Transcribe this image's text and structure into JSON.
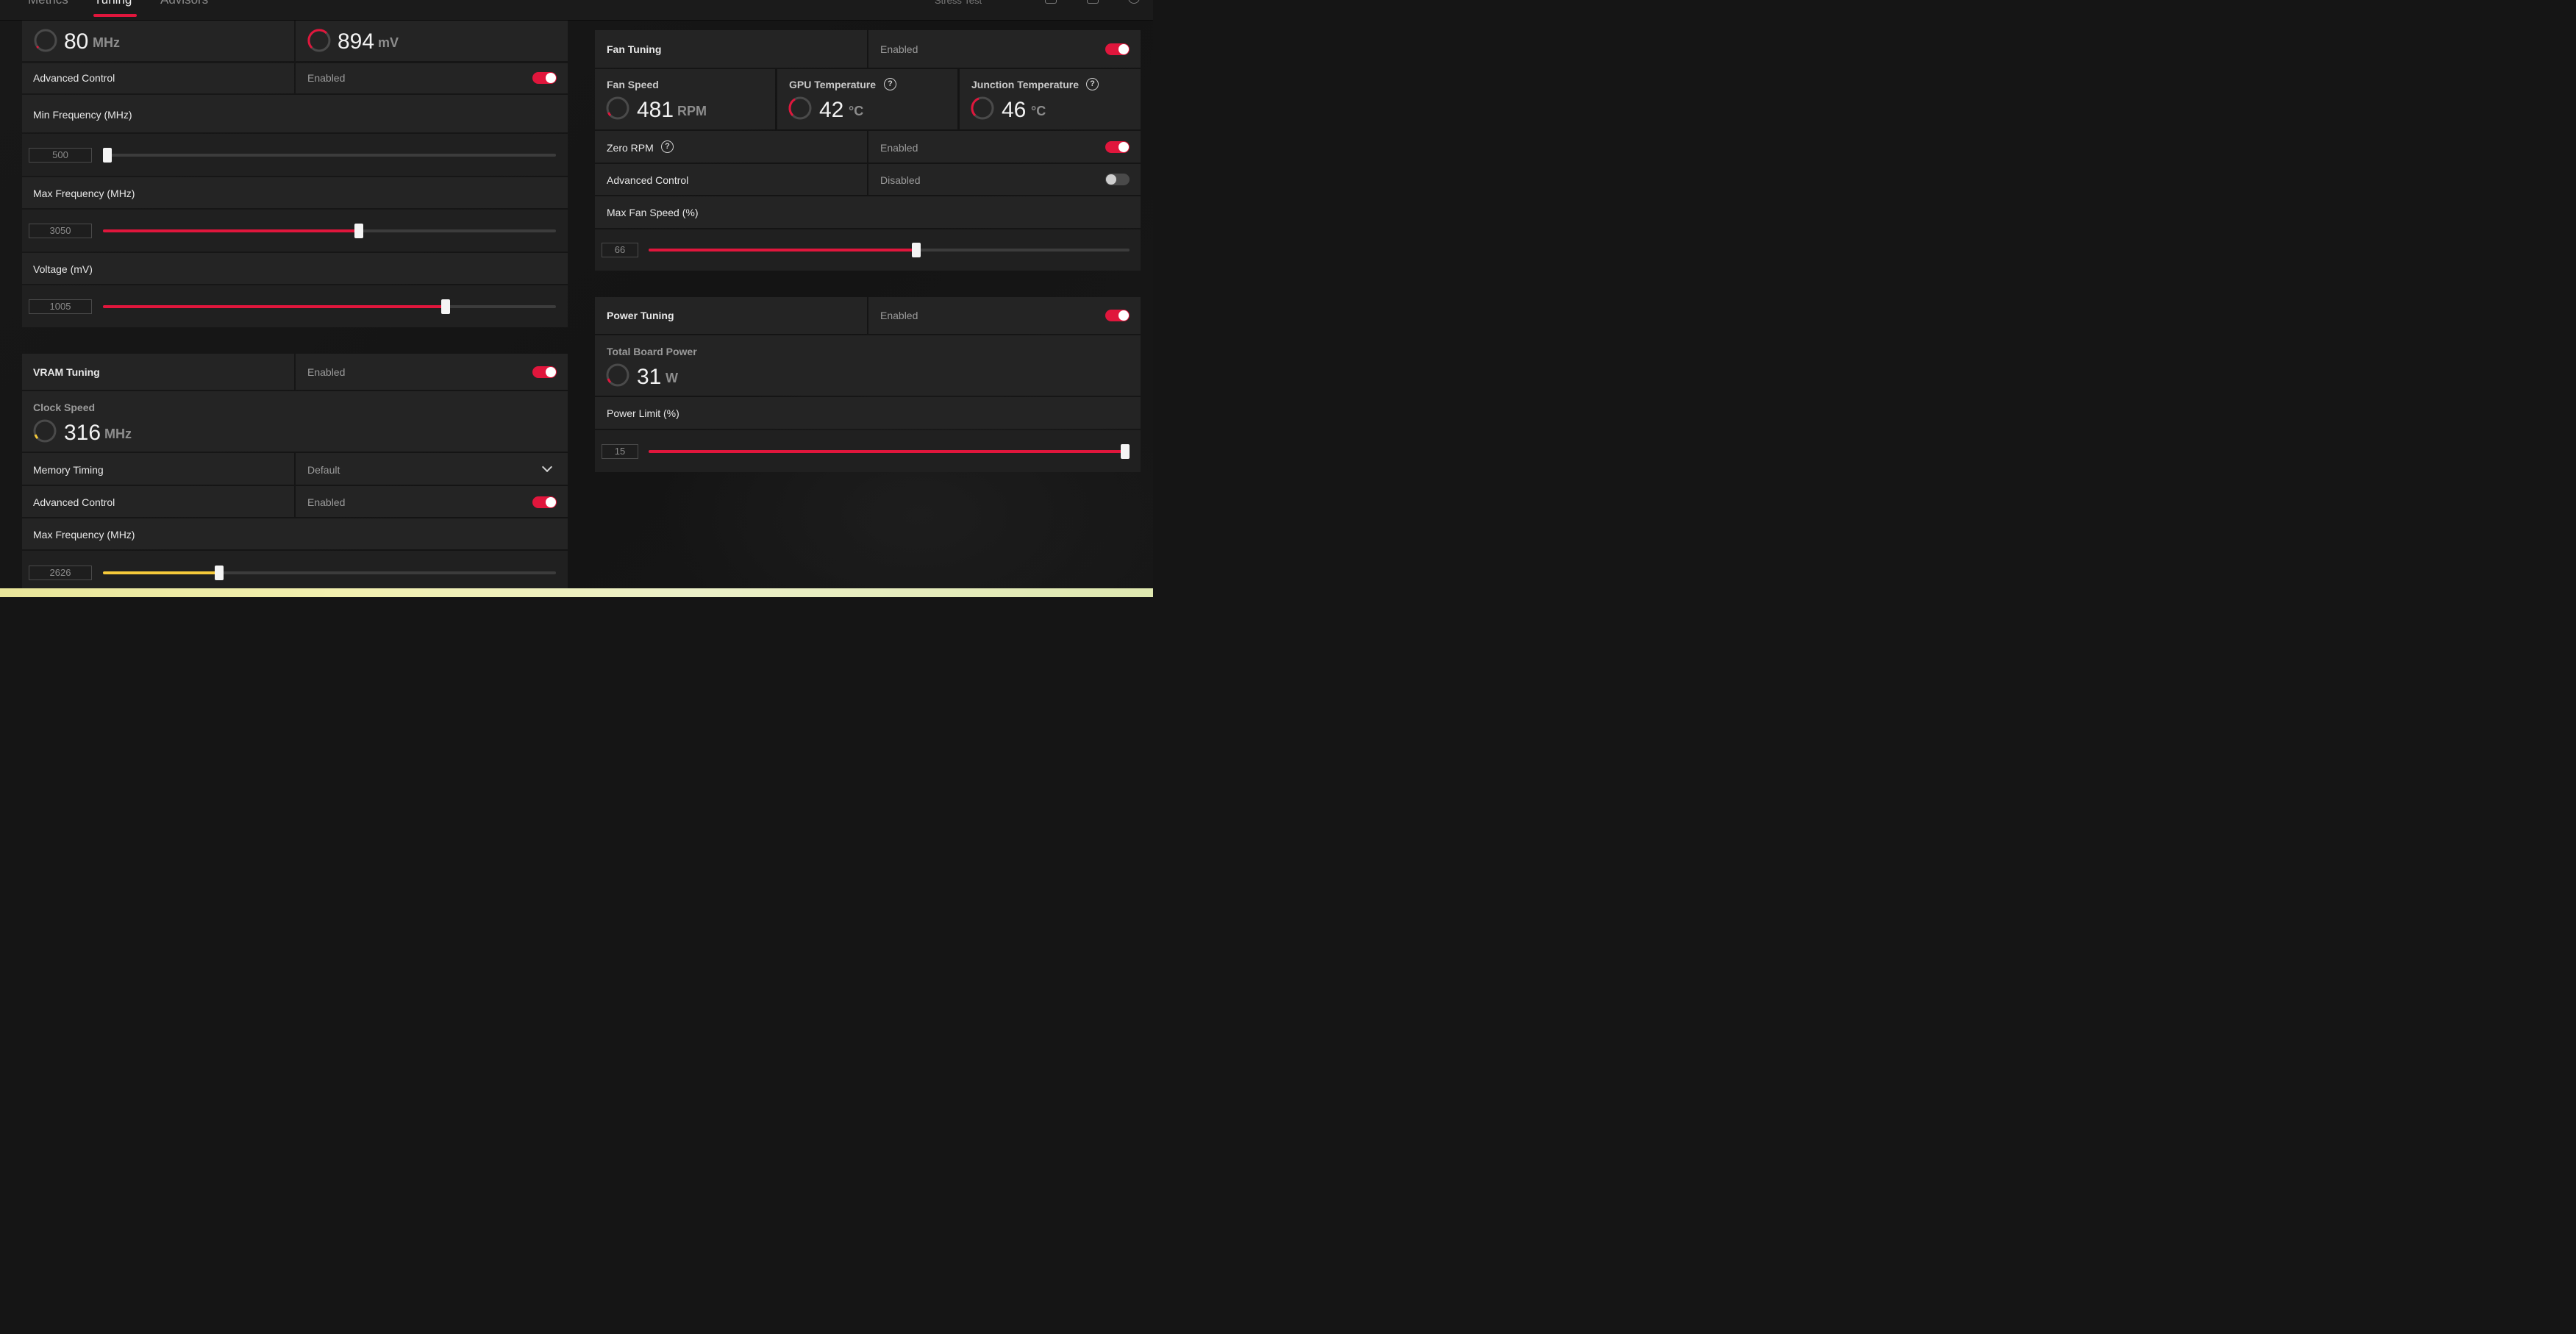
{
  "tabs": {
    "metrics": "Metrics",
    "tuning": "Tuning",
    "advisors": "Advisors"
  },
  "top_right": {
    "stress_test": "Stress Test"
  },
  "gpu_tuning": {
    "clock_value": "80",
    "clock_unit": "MHz",
    "voltage_value": "894",
    "voltage_unit": "mV",
    "advanced_control": {
      "label": "Advanced Control",
      "state": "Enabled",
      "enabled": true
    },
    "min_frequency": {
      "label": "Min Frequency (MHz)",
      "value": "500",
      "min": 500,
      "max": 3050,
      "current": 500
    },
    "max_frequency": {
      "label": "Max Frequency (MHz)",
      "value": "3050",
      "fraction": 0.565
    },
    "voltage": {
      "label": "Voltage (mV)",
      "value": "1005",
      "fraction": 0.756
    }
  },
  "vram_tuning": {
    "title": "VRAM Tuning",
    "state": "Enabled",
    "enabled": true,
    "clock_label": "Clock Speed",
    "clock_value": "316",
    "clock_unit": "MHz",
    "memory_timing": {
      "label": "Memory Timing",
      "value": "Default"
    },
    "advanced_control": {
      "label": "Advanced Control",
      "state": "Enabled",
      "enabled": true
    },
    "max_frequency": {
      "label": "Max Frequency (MHz)",
      "value": "2626",
      "fraction": 0.256
    }
  },
  "fan_tuning": {
    "title": "Fan Tuning",
    "state": "Enabled",
    "enabled": true,
    "fan_speed": {
      "label": "Fan Speed",
      "value": "481",
      "unit": "RPM"
    },
    "gpu_temp": {
      "label": "GPU Temperature",
      "value": "42",
      "unit": "°C"
    },
    "junction_temp": {
      "label": "Junction Temperature",
      "value": "46",
      "unit": "°C"
    },
    "zero_rpm": {
      "label": "Zero RPM",
      "state": "Enabled",
      "enabled": true
    },
    "advanced_control": {
      "label": "Advanced Control",
      "state": "Disabled",
      "enabled": false
    },
    "max_fan_speed": {
      "label": "Max Fan Speed (%)",
      "value": "66",
      "fraction": 0.556
    }
  },
  "power_tuning": {
    "title": "Power Tuning",
    "state": "Enabled",
    "enabled": true,
    "board_power": {
      "label": "Total Board Power",
      "value": "31",
      "unit": "W"
    },
    "power_limit": {
      "label": "Power Limit (%)",
      "value": "15",
      "fraction": 1.0
    }
  },
  "colors": {
    "accent": "#e0163c",
    "vram_accent": "#f5c93a",
    "panel": "#242424",
    "background": "#151515"
  }
}
